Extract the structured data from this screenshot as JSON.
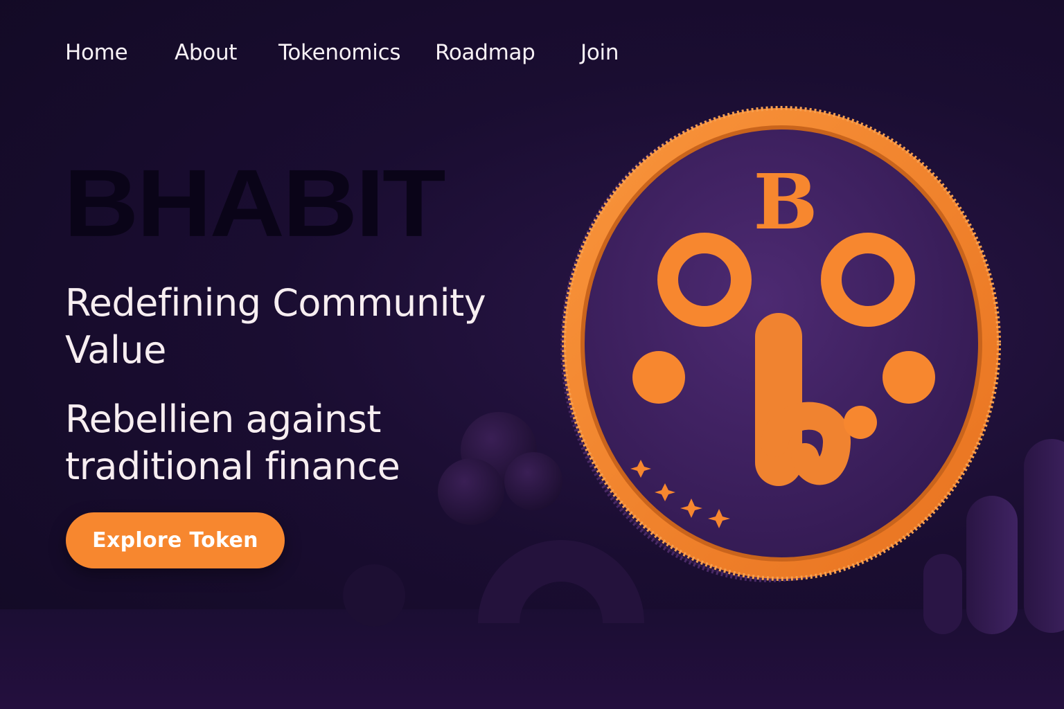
{
  "nav": {
    "items": [
      {
        "label": "Home"
      },
      {
        "label": "About"
      },
      {
        "label": "Tokenomics"
      },
      {
        "label": "Roadmap"
      },
      {
        "label": "Join"
      }
    ]
  },
  "hero": {
    "brand": "BHABIT",
    "headline": "Redefining Community Value",
    "subline": "Rebellien against traditional finance",
    "cta_label": "Explore Token"
  },
  "coin": {
    "letter": "B",
    "icon": "winking-face-coin-icon"
  },
  "colors": {
    "accent": "#f7872f",
    "background": "#1a0d31",
    "coin_face": "#3f2160",
    "brand_text": "#0a0418"
  }
}
